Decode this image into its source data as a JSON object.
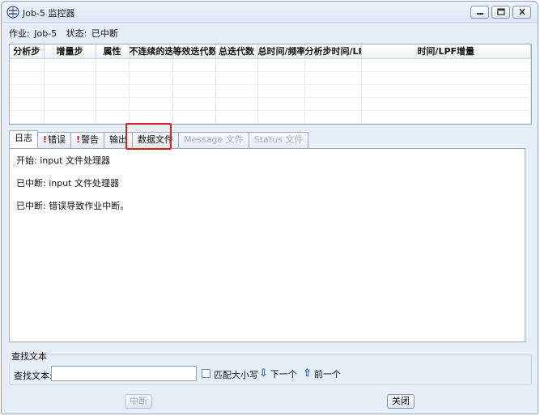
{
  "window": {
    "title": "Job-5 监控器",
    "icons": [
      "app-icon",
      "minimize-icon",
      "maximize-icon",
      "close-icon"
    ]
  },
  "status": {
    "job_label": "作业:",
    "job_value": "Job-5",
    "state_label": "状态:",
    "state_value": "已中断"
  },
  "grid": {
    "columns": [
      "分析步",
      "增量步",
      "属性",
      "不连续的迭代",
      "等效迭代数",
      "总迭代数",
      "总时间/频率",
      "分析步时间/LPF",
      "时间/LPF增量"
    ],
    "rows": []
  },
  "tabs": [
    {
      "label": "日志",
      "bang": "",
      "state": "active"
    },
    {
      "label": "错误",
      "bang": "!",
      "state": "normal"
    },
    {
      "label": "警告",
      "bang": "!",
      "state": "normal"
    },
    {
      "label": "输出",
      "bang": "",
      "state": "normal"
    },
    {
      "label": "数据文件",
      "bang": "",
      "state": "highlighted"
    },
    {
      "label": "Message 文件",
      "bang": "",
      "state": "disabled"
    },
    {
      "label": "Status 文件",
      "bang": "",
      "state": "disabled"
    }
  ],
  "log": {
    "lines": [
      "开始:   input 文件处理器",
      "已中断:   input 文件处理器",
      "已中断:   错误导致作业中断。"
    ]
  },
  "find": {
    "group_label": "查找文本",
    "field_label": "查找文本:",
    "value": "",
    "match_case_label": "匹配大小写",
    "match_case_checked": false,
    "next_label": "下一个",
    "prev_label": "前一个"
  },
  "buttons": {
    "abort": "中断",
    "close": "关闭"
  },
  "colors": {
    "highlight_box": "#e02020",
    "error_mark": "#d0141c",
    "arrow": "#2d5aa8"
  }
}
